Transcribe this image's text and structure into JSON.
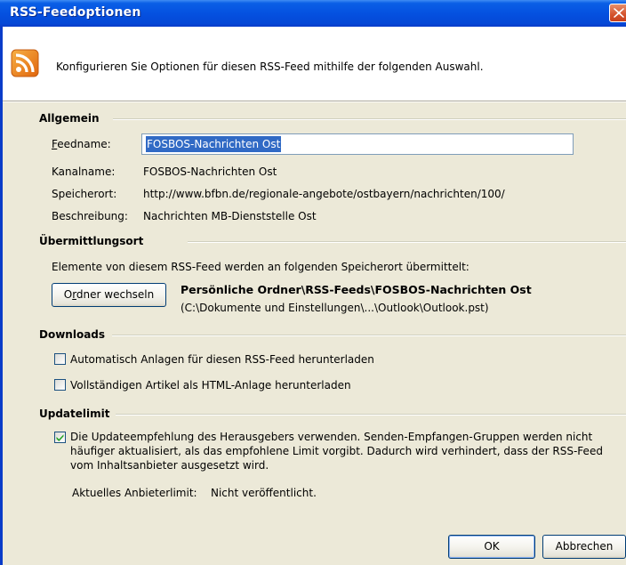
{
  "window": {
    "title": "RSS-Feedoptionen"
  },
  "header": {
    "description": "Konfigurieren Sie Optionen für diesen RSS-Feed mithilfe der folgenden Auswahl."
  },
  "allgemein": {
    "heading": "Allgemein",
    "feedname_label": "Feedname:",
    "feedname_value": "FOSBOS-Nachrichten Ost",
    "kanalname_label": "Kanalname:",
    "kanalname_value": "FOSBOS-Nachrichten Ost",
    "speicherort_label": "Speicherort:",
    "speicherort_value": "http://www.bfbn.de/regionale-angebote/ostbayern/nachrichten/100/",
    "beschreibung_label": "Beschreibung:",
    "beschreibung_value": "Nachrichten MB-Dienststelle Ost"
  },
  "uebermittlungsort": {
    "heading": "Übermittlungsort",
    "description": "Elemente von diesem RSS-Feed werden an folgenden Speicherort übermittelt:",
    "button_label": "Ordner wechseln",
    "folder_path": "Persönliche Ordner\\RSS-Feeds\\FOSBOS-Nachrichten Ost",
    "file_path": "(C:\\Dokumente und Einstellungen\\...\\Outlook\\Outlook.pst)"
  },
  "downloads": {
    "heading": "Downloads",
    "option_attachments": "Automatisch Anlagen für diesen RSS-Feed herunterladen",
    "option_attachments_checked": false,
    "option_full_article": "Vollständigen Artikel als HTML-Anlage herunterladen",
    "option_full_article_checked": false
  },
  "updatelimit": {
    "heading": "Updatelimit",
    "option_text_line1": "Die Updateempfehlung des Herausgebers verwenden. Senden-Empfangen-Gruppen werden nicht",
    "option_text_line2": "häufiger aktualisiert, als das empfohlene Limit vorgibt. Dadurch wird verhindert, dass der RSS-Feed",
    "option_text_line3": "vom Inhaltsanbieter ausgesetzt wird.",
    "option_checked": true,
    "current_limit_label": "Aktuelles Anbieterlimit:",
    "current_limit_value": "Nicht veröffentlicht."
  },
  "footer": {
    "ok_label": "OK",
    "cancel_label": "Abbrechen"
  },
  "colors": {
    "titlebar": "#0551e0",
    "rss_orange": "#f08a1e",
    "selection": "#316ac5",
    "checkmark": "#21a121"
  }
}
